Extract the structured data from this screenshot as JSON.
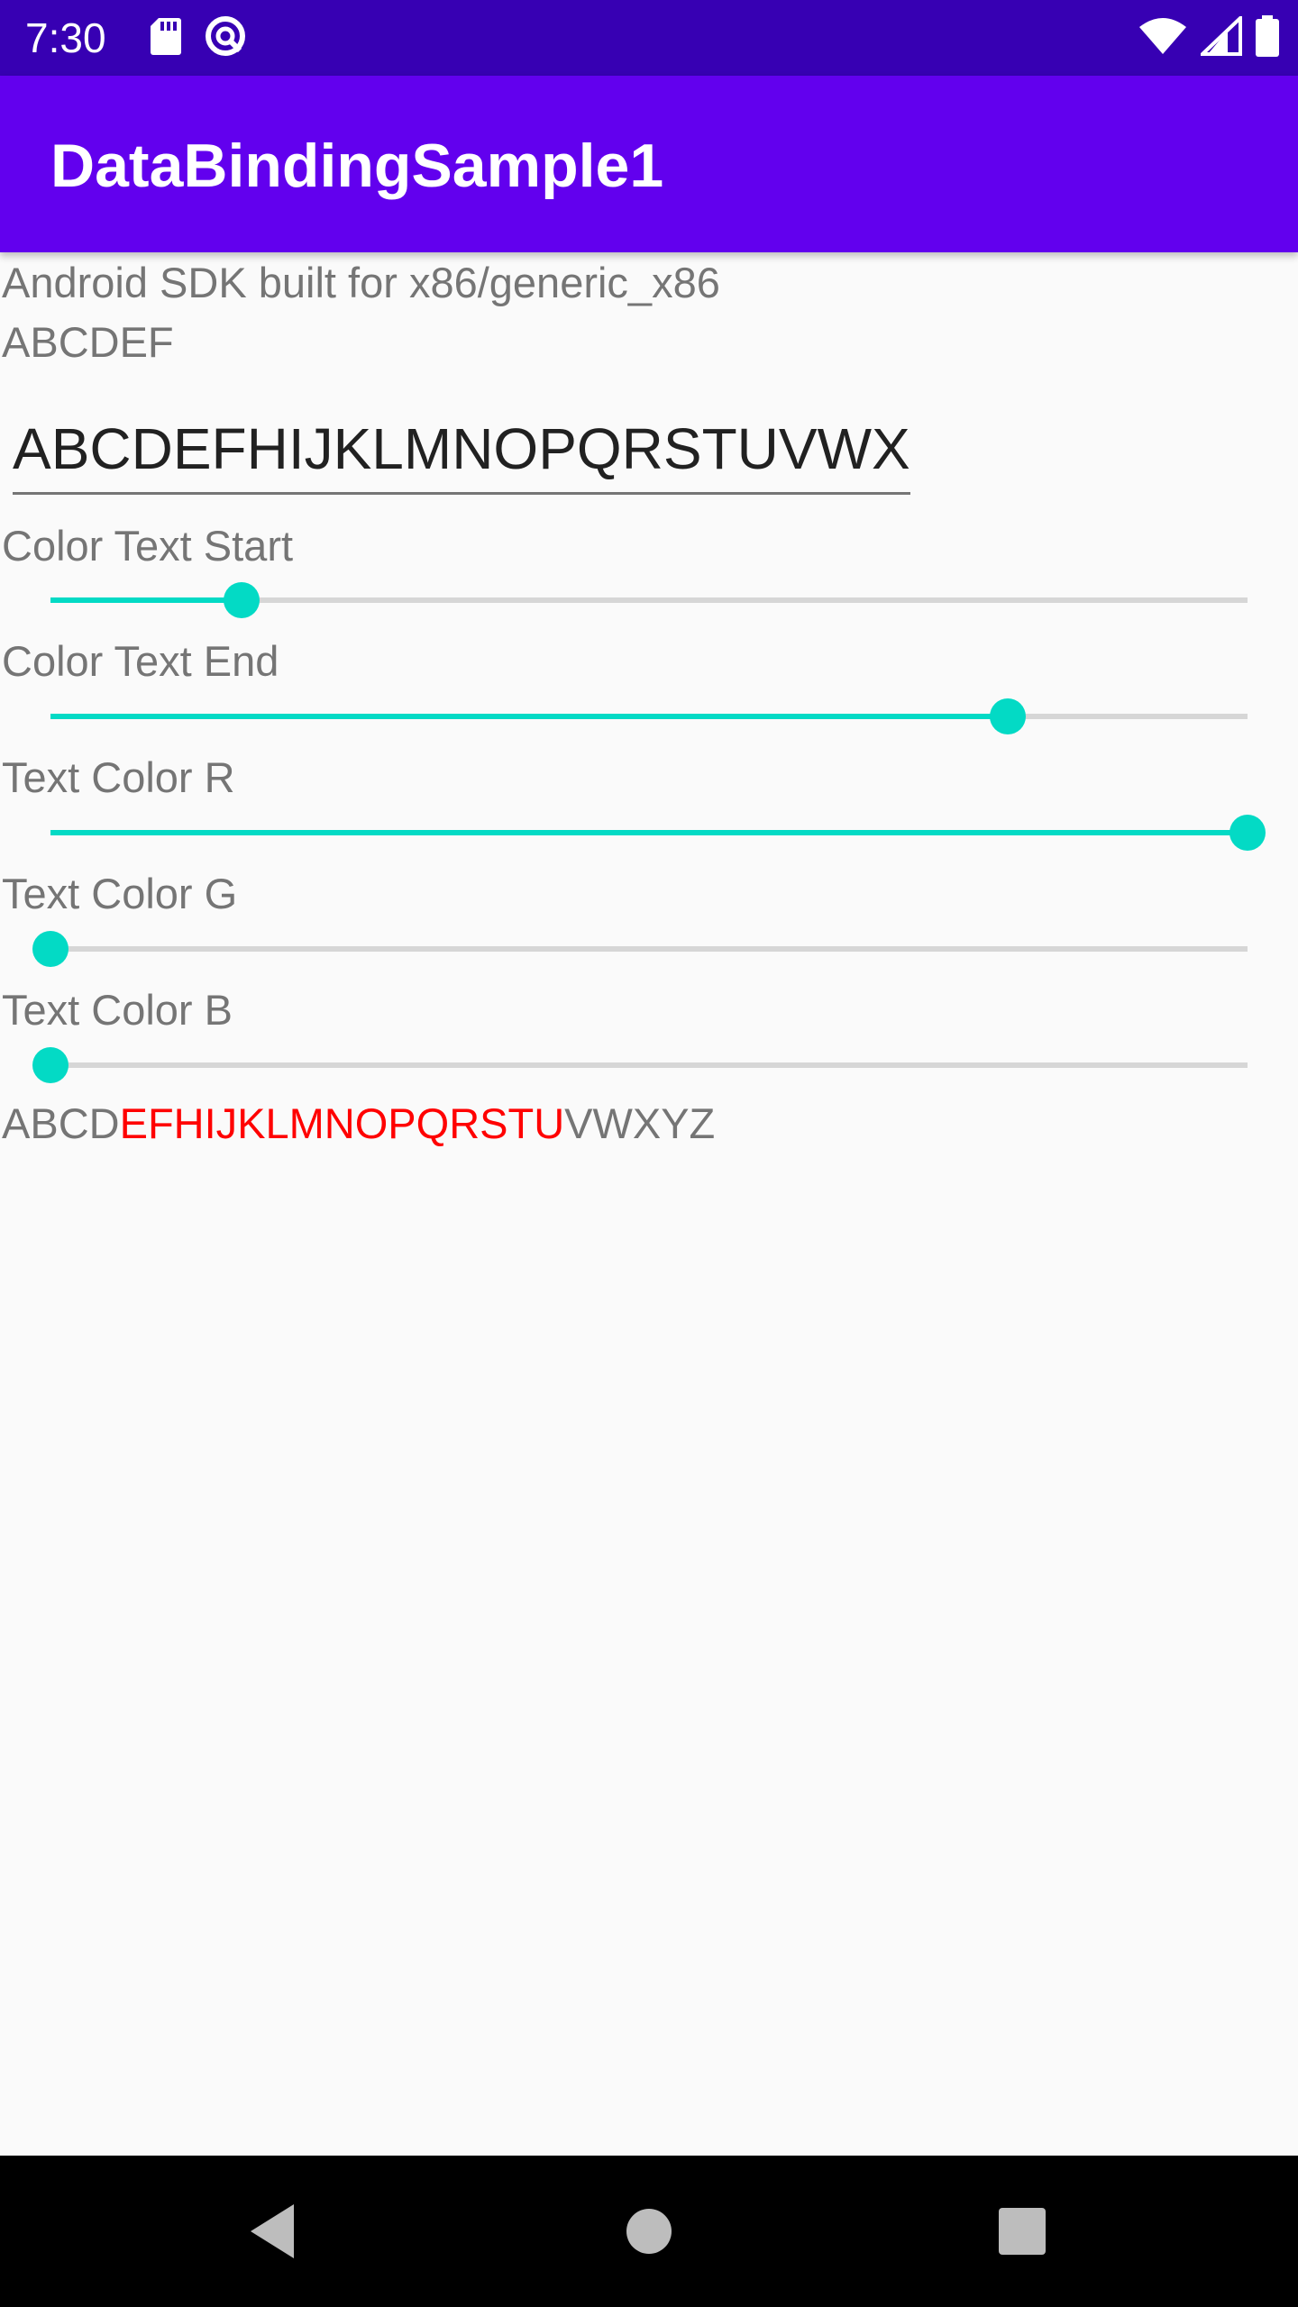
{
  "status_bar": {
    "time": "7:30",
    "icons_left": [
      "sd-card-icon",
      "data-saver-icon"
    ],
    "icons_right": [
      "wifi-icon",
      "signal-icon",
      "battery-icon"
    ]
  },
  "app_bar": {
    "title": "DataBindingSample1",
    "color": "#6200ee",
    "status_color": "#3700b3"
  },
  "main": {
    "device_text": "Android SDK built for x86/generic_x86",
    "short_text": "ABCDEF",
    "edit_value": "ABCDEFHIJKLMNOPQRSTUVWXYZ",
    "accent_color": "#03dac5",
    "sliders": [
      {
        "label": "Color Text Start",
        "fraction": 0.16
      },
      {
        "label": "Color Text End",
        "fraction": 0.8
      },
      {
        "label": "Text Color R",
        "fraction": 1.0
      },
      {
        "label": "Text Color G",
        "fraction": 0.0
      },
      {
        "label": "Text Color B",
        "fraction": 0.0
      }
    ],
    "result": {
      "before": "ABCD",
      "highlight": "EFHIJKLMNOPQRSTU",
      "after": "VWXYZ",
      "highlight_color": "#ff0000"
    }
  },
  "nav_bar": {
    "back_icon": "back-triangle-icon",
    "home_icon": "home-circle-icon",
    "recents_icon": "recents-square-icon"
  }
}
